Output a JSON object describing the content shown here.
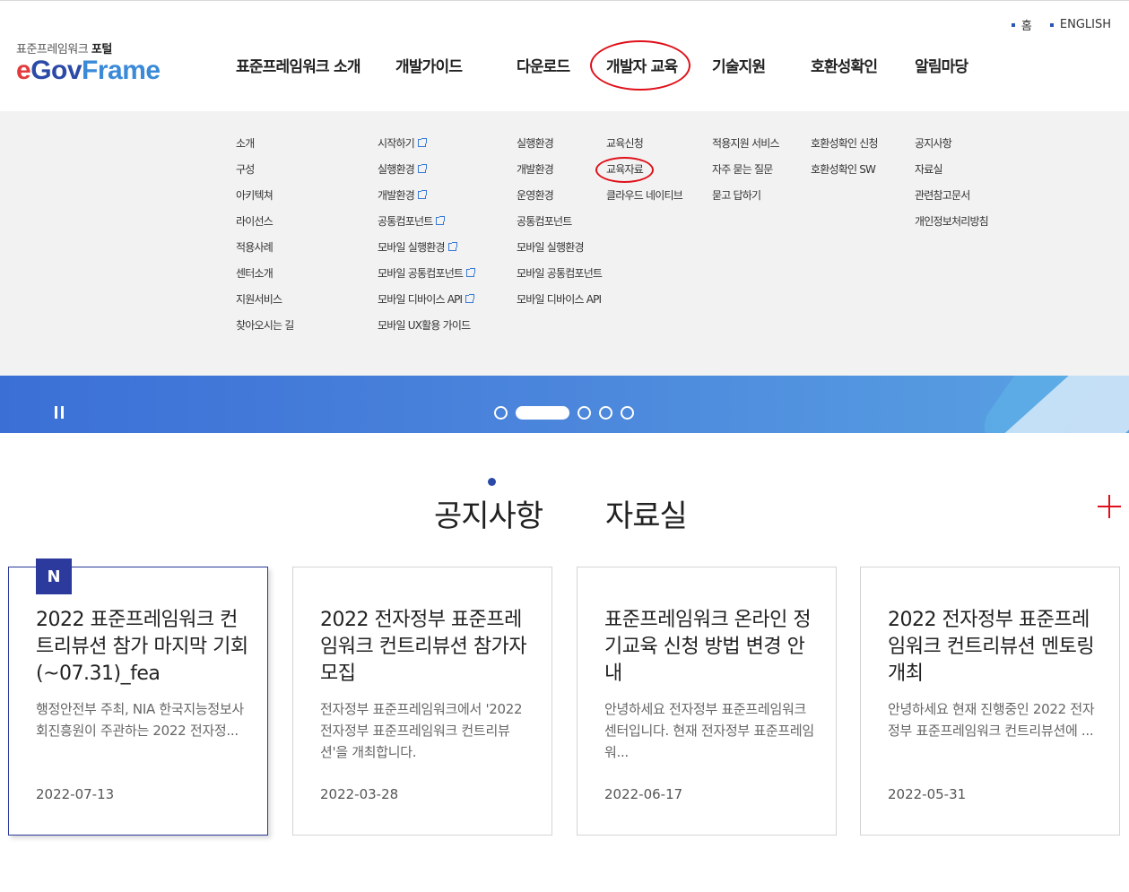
{
  "util": {
    "home": "홈",
    "english": "ENGLISH"
  },
  "logo": {
    "sub_normal": "표준프레임워크 ",
    "sub_bold": "포털",
    "e": "e",
    "gov": "Gov",
    "frame": "Frame"
  },
  "gnb": [
    {
      "label": "표준프레임워크 소개"
    },
    {
      "label": "개발가이드"
    },
    {
      "label": "다운로드"
    },
    {
      "label": "개발자 교육"
    },
    {
      "label": "기술지원"
    },
    {
      "label": "호환성확인"
    },
    {
      "label": "알림마당"
    }
  ],
  "submenu": {
    "intro": [
      "소개",
      "구성",
      "아키텍쳐",
      "라이선스",
      "적용사례",
      "센터소개",
      "지원서비스",
      "찾아오시는 길"
    ],
    "guide": [
      "시작하기",
      "실행환경",
      "개발환경",
      "공통컴포넌트",
      "모바일 실행환경",
      "모바일 공통컴포넌트",
      "모바일 디바이스 API",
      "모바일 UX활용 가이드"
    ],
    "download": [
      "실행환경",
      "개발환경",
      "운영환경",
      "공통컴포넌트",
      "모바일 실행환경",
      "모바일 공통컴포넌트",
      "모바일 디바이스 API"
    ],
    "edu": [
      "교육신청",
      "교육자료",
      "클라우드 네이티브"
    ],
    "support": [
      "적용지원 서비스",
      "자주 묻는 질문",
      "묻고 답하기"
    ],
    "compat": [
      "호환성확인 신청",
      "호환성확인 SW"
    ],
    "notice": [
      "공지사항",
      "자료실",
      "관련참고문서",
      "개인정보처리방침"
    ]
  },
  "tabs": {
    "notice": "공지사항",
    "archive": "자료실"
  },
  "cards": [
    {
      "badge": "N",
      "title": "2022 표준프레임워크 컨트리뷰션 참가 마지막 기회(~07.31)_fea",
      "desc": "행정안전부 주최, NIA 한국지능정보사회진흥원이 주관하는 2022 전자정...",
      "date": "2022-07-13"
    },
    {
      "title": "2022 전자정부 표준프레임워크 컨트리뷰션 참가자 모집",
      "desc": "전자정부 표준프레임워크에서 '2022 전자정부 표준프레임워크 컨트리뷰션'을 개최합니다.",
      "date": "2022-03-28"
    },
    {
      "title": "표준프레임워크 온라인 정기교육 신청 방법 변경 안내",
      "desc": "안녕하세요 전자정부 표준프레임워크 센터입니다. 현재 전자정부 표준프레임워...",
      "date": "2022-06-17"
    },
    {
      "title": "2022 전자정부 표준프레임워크 컨트리뷰션 멘토링 개최",
      "desc": "안녕하세요  현재 진행중인 2022 전자정부 표준프레임워크 컨트리뷰션에 ...",
      "date": "2022-05-31"
    }
  ],
  "colors": {
    "brand_blue": "#2b4aa8",
    "accent_red": "#e0101a",
    "panel_bg": "#f2f2f2"
  }
}
